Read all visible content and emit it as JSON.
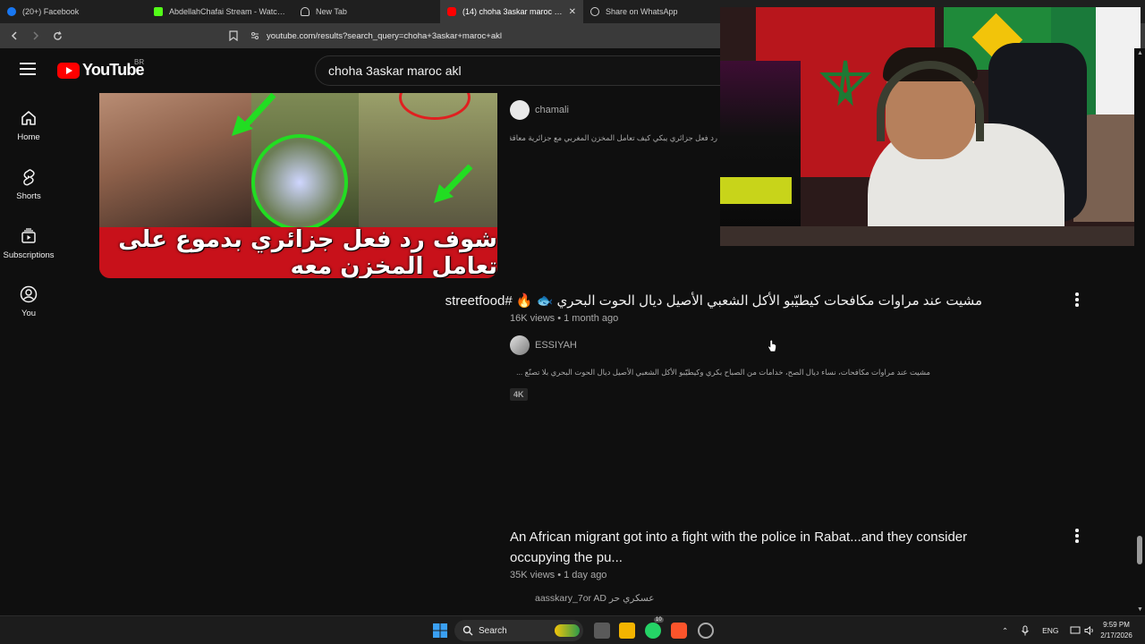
{
  "browser": {
    "tabs": [
      {
        "title": "(20+) Facebook",
        "favicon_color": "#1877f2",
        "active": false
      },
      {
        "title": "AbdellahChafai Stream - Watch Live o",
        "favicon_color": "#53fc18",
        "active": false
      },
      {
        "title": "New Tab",
        "favicon_color": "#cfcfcf",
        "active": false
      },
      {
        "title": "(14) choha 3askar maroc akl - Yo",
        "favicon_color": "#ff0000",
        "active": true
      },
      {
        "title": "Share on WhatsApp",
        "favicon_color": "#cfcfcf",
        "active": false
      }
    ],
    "url": "youtube.com/results?search_query=choha+3askar+maroc+akl"
  },
  "youtube": {
    "logo_text": "YouTube",
    "country_code": "BR",
    "search_query": "choha 3askar maroc akl",
    "guide": [
      {
        "label": "Home",
        "icon": "home-icon"
      },
      {
        "label": "Shorts",
        "icon": "shorts-icon"
      },
      {
        "label": "Subscriptions",
        "icon": "subscriptions-icon"
      },
      {
        "label": "You",
        "icon": "you-icon"
      }
    ]
  },
  "results": [
    {
      "thumbnail_caption": "شوف رد فعل جزائري بدموع على تعامل المخزن معه",
      "channel": "chamali",
      "description": "رد فعل جزائري يبكي كيف تعامل المخزن المغربي مع جزائرية معاقة"
    },
    {
      "title": "مشيت عند مراوات مكافحات كيطيّبو الأكل الشعبي الأصيل ديال الحوت البحري 🐟 🔥 #streetfood",
      "views": "16K views",
      "age": "1 month ago",
      "channel": "ESSIYAH",
      "description": "مشيت عند مراوات مكافحات، نساء ديال الصح، خدامات من الصباح بكري وكيطيّبو الأكل الشعبي الأصيل ديال الحوت البحري بلا تصنّع ...",
      "badge": "4K"
    },
    {
      "title_line1": "An African migrant got into a fight with the police in Rabat...and they consider",
      "title_line2": "occupying the pu...",
      "views": "35K views",
      "age": "1 day ago",
      "channel": "aasskary_7or AD عسكري حر"
    }
  ],
  "taskbar": {
    "search_label": "Search",
    "language": "ENG",
    "time": "9:59 PM",
    "date": "2/17/2026",
    "whatsapp_badge": "10"
  },
  "colors": {
    "background": "#0f0f0f",
    "youtube_red": "#ff0000",
    "secondary_text": "#aaaaaa"
  }
}
